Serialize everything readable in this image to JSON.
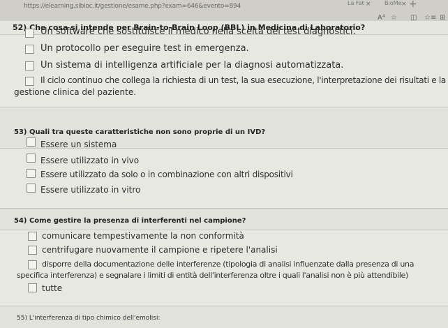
{
  "browser": {
    "url": "https://elearning.sibioc.it/gestione/esame.php?exam=646&evento=894",
    "tab_1": "La Fat",
    "tab_2": "BioMe",
    "close_glyph": "×",
    "new_tab_glyph": "+"
  },
  "toolbar": {
    "read_aloud": "A⁴",
    "favorite": "☆",
    "split": "◫",
    "favorites": "☆≡",
    "collections": "⊞"
  },
  "questions": [
    {
      "title": "52) Che cosa si intende per Brain-to-Brain Loop (BBL) in Medicina di Laboratorio?",
      "options": [
        "Un software che sostituisce il medico nella scelta dei test diagnostici.",
        "Un protocollo per eseguire test in emergenza.",
        "Un sistema di intelligenza artificiale per la diagnosi automatizzata.",
        "Il ciclo continuo che collega la richiesta di un test, la sua esecuzione, l'interpretazione dei risultati e la",
        "gestione clinica del paziente."
      ]
    },
    {
      "title": "53) Quali tra queste caratteristiche non sono proprie di un IVD?",
      "options": [
        "Essere un sistema",
        "Essere utilizzato in vivo",
        "Essere utilizzato da solo o in combinazione con altri dispositivi",
        "Essere utilizzato in vitro"
      ]
    },
    {
      "title": "54) Come gestire la presenza di interferenti nel campione?",
      "options": [
        "comunicare tempestivamente la non conformità",
        "centrifugare nuovamente il campione e ripetere l'analisi",
        "disporre della documentazione delle interferenze (tipologia di analisi influenzate dalla presenza di una",
        "specifica interferenza) e segnalare i limiti di entità dell'interferenza oltre i quali l'analisi non è più attendibile)",
        "tutte"
      ]
    },
    {
      "title": "55) L'interferenza di tipo chimico dell'emolisi:"
    }
  ]
}
